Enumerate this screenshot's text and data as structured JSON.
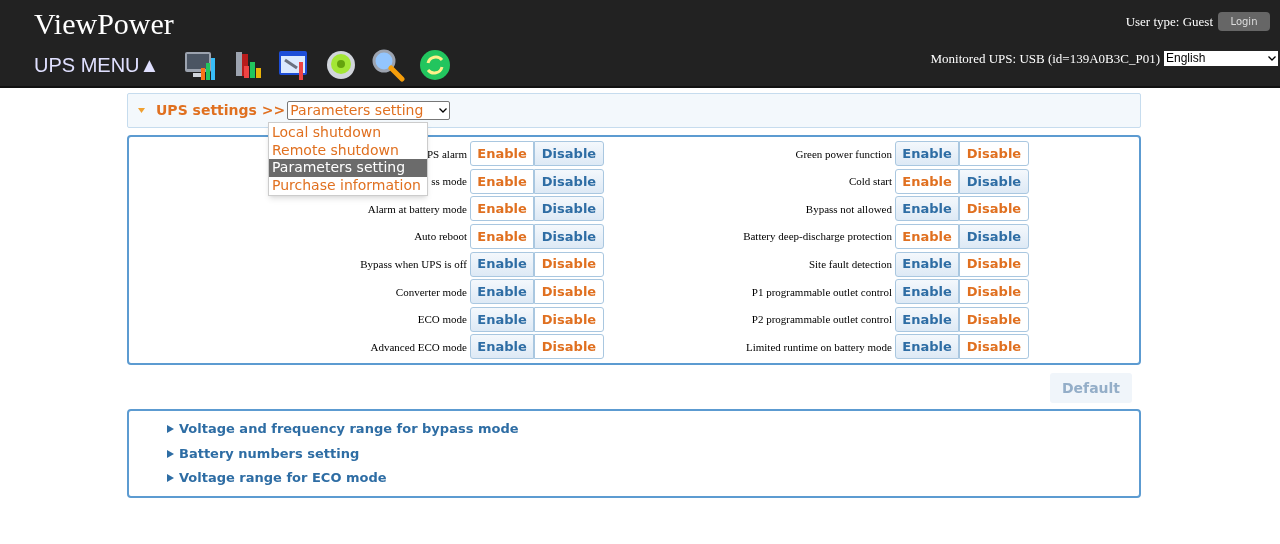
{
  "header": {
    "title": "ViewPower",
    "menu_label": "UPS MENU▲",
    "user_type": "User type: Guest",
    "login_button": "Login",
    "monitored": "Monitored UPS: USB (id=139A0B3C_P01)",
    "language": "English"
  },
  "settings_bar": {
    "title": "UPS settings >>",
    "select_value": "Parameters setting",
    "options": [
      {
        "label": "Local shutdown",
        "selected": false
      },
      {
        "label": "Remote shutdown",
        "selected": false
      },
      {
        "label": "Parameters setting",
        "selected": true
      },
      {
        "label": "Purchase information",
        "selected": false
      }
    ]
  },
  "parameters": {
    "columns": [
      [
        {
          "label": "PS alarm",
          "buttons": [
            {
              "label": "Enable",
              "selected": true
            },
            {
              "label": "Disable",
              "selected": false
            }
          ]
        },
        {
          "label": "ss mode",
          "buttons": [
            {
              "label": "Enable",
              "selected": true
            },
            {
              "label": "Disable",
              "selected": false
            }
          ]
        },
        {
          "label": "Alarm at battery mode",
          "buttons": [
            {
              "label": "Enable",
              "selected": true
            },
            {
              "label": "Disable",
              "selected": false
            }
          ]
        },
        {
          "label": "Auto reboot",
          "buttons": [
            {
              "label": "Enable",
              "selected": true
            },
            {
              "label": "Disable",
              "selected": false
            }
          ]
        },
        {
          "label": "Bypass when UPS is off",
          "buttons": [
            {
              "label": "Enable",
              "selected": false
            },
            {
              "label": "Disable",
              "selected": true
            }
          ]
        },
        {
          "label": "Converter mode",
          "buttons": [
            {
              "label": "Enable",
              "selected": false
            },
            {
              "label": "Disable",
              "selected": true
            }
          ]
        },
        {
          "label": "ECO mode",
          "buttons": [
            {
              "label": "Enable",
              "selected": false
            },
            {
              "label": "Disable",
              "selected": true
            }
          ]
        },
        {
          "label": "Advanced ECO mode",
          "buttons": [
            {
              "label": "Enable",
              "selected": false
            },
            {
              "label": "Disable",
              "selected": true
            }
          ]
        }
      ],
      [
        {
          "label": "Green power function",
          "buttons": [
            {
              "label": "Enable",
              "selected": false
            },
            {
              "label": "Disable",
              "selected": true
            }
          ]
        },
        {
          "label": "Cold start",
          "buttons": [
            {
              "label": "Enable",
              "selected": true
            },
            {
              "label": "Disable",
              "selected": false
            }
          ]
        },
        {
          "label": "Bypass not allowed",
          "buttons": [
            {
              "label": "Enable",
              "selected": false
            },
            {
              "label": "Disable",
              "selected": true
            }
          ]
        },
        {
          "label": "Battery deep-discharge protection",
          "buttons": [
            {
              "label": "Enable",
              "selected": true
            },
            {
              "label": "Disable",
              "selected": false
            }
          ]
        },
        {
          "label": "Site fault detection",
          "buttons": [
            {
              "label": "Enable",
              "selected": false
            },
            {
              "label": "Disable",
              "selected": true
            }
          ]
        },
        {
          "label": "P1 programmable outlet control",
          "buttons": [
            {
              "label": "Enable",
              "selected": false
            },
            {
              "label": "Disable",
              "selected": true
            }
          ]
        },
        {
          "label": "P2 programmable outlet control",
          "buttons": [
            {
              "label": "Enable",
              "selected": false
            },
            {
              "label": "Disable",
              "selected": true
            }
          ]
        },
        {
          "label": "Limited runtime on battery mode",
          "buttons": [
            {
              "label": "Enable",
              "selected": false
            },
            {
              "label": "Disable",
              "selected": true
            }
          ]
        }
      ]
    ],
    "default_button": {
      "label": "Default",
      "disabled": true
    }
  },
  "sections": [
    {
      "label": "Voltage and frequency range for bypass mode",
      "expanded": false
    },
    {
      "label": "Battery numbers setting",
      "expanded": false
    },
    {
      "label": "Voltage range for ECO mode",
      "expanded": false
    }
  ]
}
